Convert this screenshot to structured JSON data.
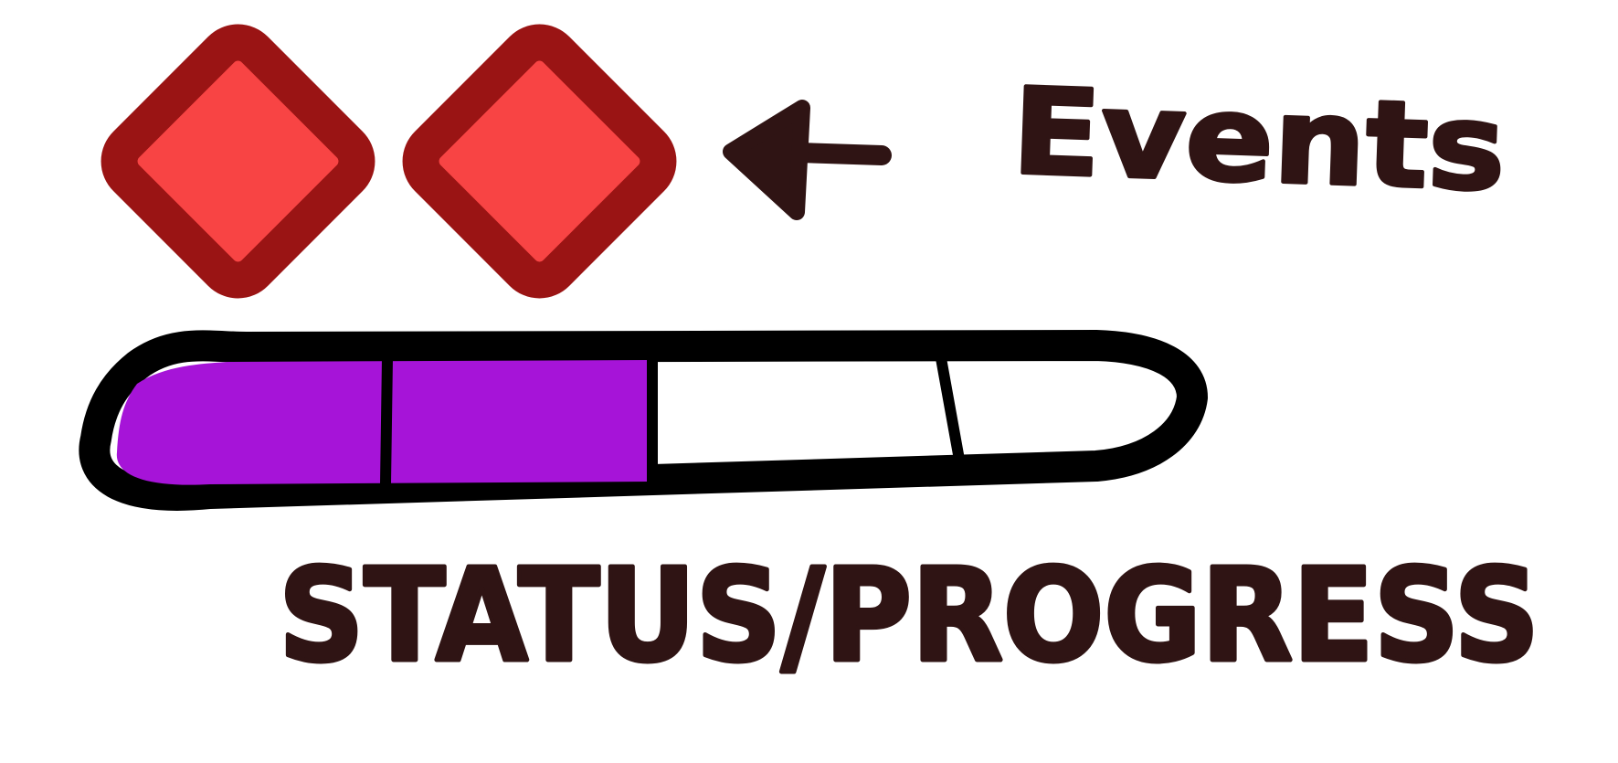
{
  "labels": {
    "events": "Events",
    "status_progress": "STATUS/PROGRESS"
  },
  "events": {
    "count": 2,
    "icon": "diamond-icon",
    "fill_color": "#f84444",
    "border_color": "#9a1414"
  },
  "progress": {
    "segments": 4,
    "filled_segments": 2,
    "fill_color": "#a614d8",
    "outline_color": "#000000"
  },
  "colors": {
    "ink": "#2f1414",
    "background": "#ffffff"
  }
}
